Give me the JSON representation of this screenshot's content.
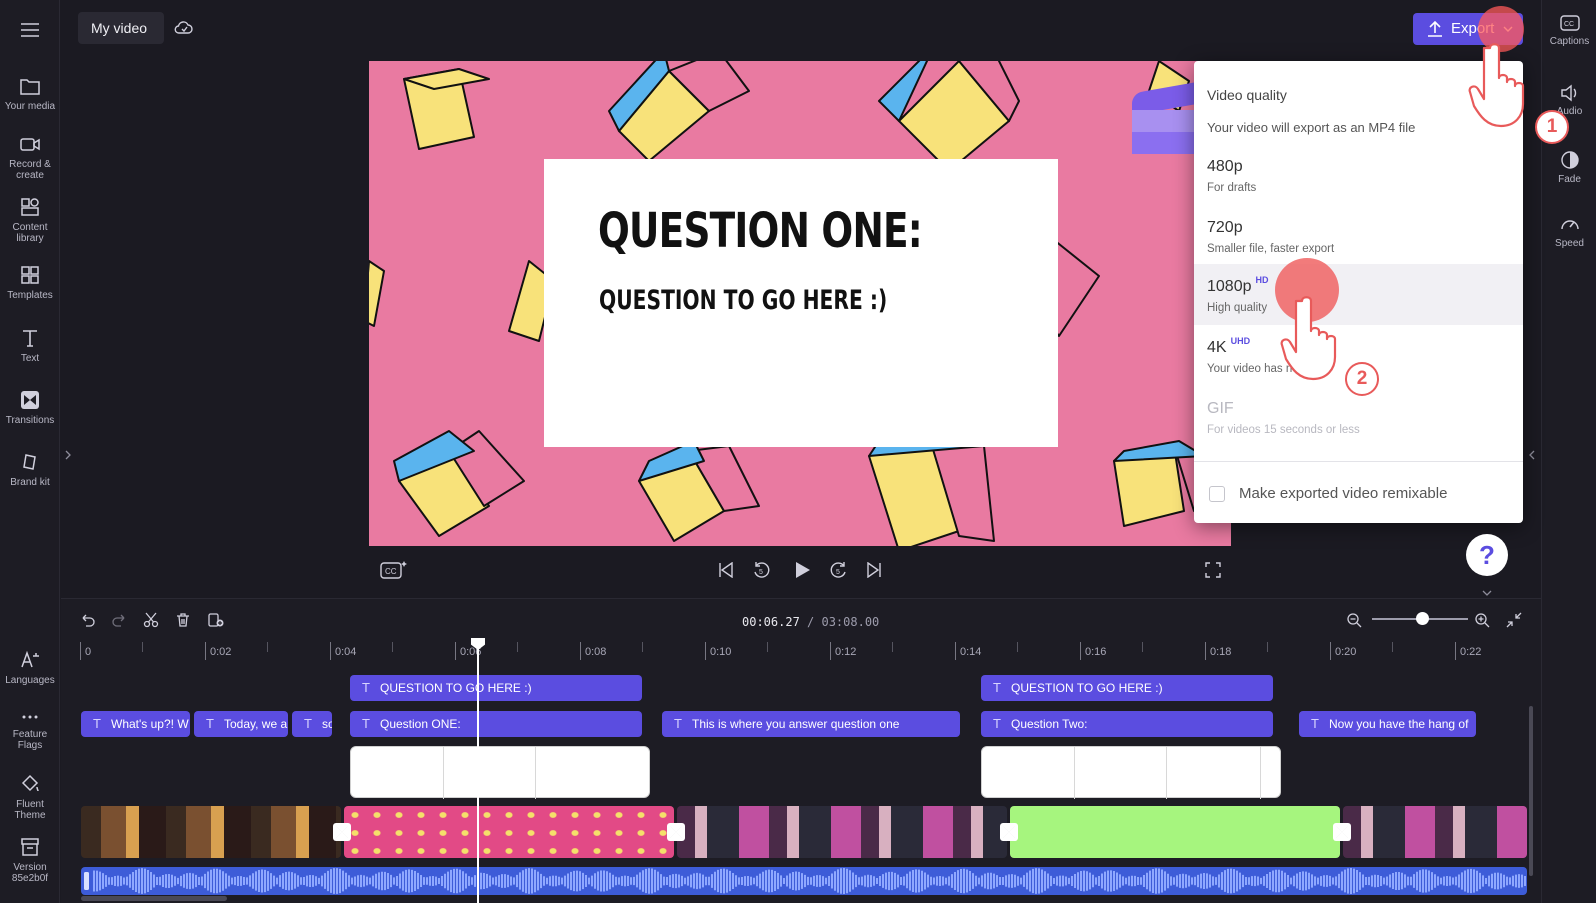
{
  "project": {
    "title": "My video"
  },
  "left_sidebar": {
    "items": [
      {
        "label": "Your media",
        "icon": "folder-icon"
      },
      {
        "label": "Record & create",
        "icon": "camera-icon"
      },
      {
        "label": "Content library",
        "icon": "library-icon"
      },
      {
        "label": "Templates",
        "icon": "templates-icon"
      },
      {
        "label": "Text",
        "icon": "text-icon"
      },
      {
        "label": "Transitions",
        "icon": "transitions-icon"
      },
      {
        "label": "Brand kit",
        "icon": "brand-kit-icon"
      }
    ],
    "bottom_items": [
      {
        "label": "Languages",
        "icon": "languages-icon"
      },
      {
        "label": "Feature Flags",
        "icon": "more-icon"
      },
      {
        "label": "Fluent Theme",
        "icon": "paint-bucket-icon"
      },
      {
        "label": "Version 85e2b0f",
        "icon": "archive-icon"
      }
    ]
  },
  "right_sidebar": {
    "items": [
      {
        "label": "Captions",
        "icon": "captions-icon"
      },
      {
        "label": "Audio",
        "icon": "speaker-icon"
      },
      {
        "label": "Fade",
        "icon": "fade-icon"
      },
      {
        "label": "Speed",
        "icon": "speed-icon"
      }
    ]
  },
  "export": {
    "label": "Export"
  },
  "preview": {
    "title": "QUESTION ONE:",
    "subtitle": "QUESTION TO GO HERE :)"
  },
  "dropdown": {
    "heading": "Video quality",
    "subheading": "Your video will export as an MP4 file",
    "options": [
      {
        "name": "480p",
        "badge": "",
        "desc": "For drafts",
        "disabled": false
      },
      {
        "name": "720p",
        "badge": "",
        "desc": "Smaller file, faster export",
        "disabled": false
      },
      {
        "name": "1080p",
        "badge": "HD",
        "desc": "High quality",
        "disabled": false
      },
      {
        "name": "4K",
        "badge": "UHD",
        "desc": "Your video has no",
        "disabled": false
      },
      {
        "name": "GIF",
        "badge": "",
        "desc": "For videos 15 seconds or less",
        "disabled": true
      }
    ],
    "remix_label": "Make exported video remixable",
    "remix_checked": false
  },
  "steps": {
    "one": "1",
    "two": "2"
  },
  "help": {
    "label": "?"
  },
  "timeline": {
    "current_time": "00:06.27",
    "total_time": "/ 03:08.00",
    "ticks": [
      "0",
      "0:02",
      "0:04",
      "0:06",
      "0:08",
      "0:10",
      "0:12",
      "0:14",
      "0:16",
      "0:18",
      "0:20",
      "0:22"
    ],
    "text_track_1": [
      {
        "label": "QUESTION TO GO HERE :)"
      },
      {
        "label": "QUESTION TO GO HERE :)"
      }
    ],
    "text_track_2": [
      {
        "label": "What's up?! W"
      },
      {
        "label": "Today, we a"
      },
      {
        "label": "so"
      },
      {
        "label": "Question ONE:"
      },
      {
        "label": "This is where you answer question one"
      },
      {
        "label": "Question Two:"
      },
      {
        "label": "Now you have the hang of"
      }
    ]
  }
}
